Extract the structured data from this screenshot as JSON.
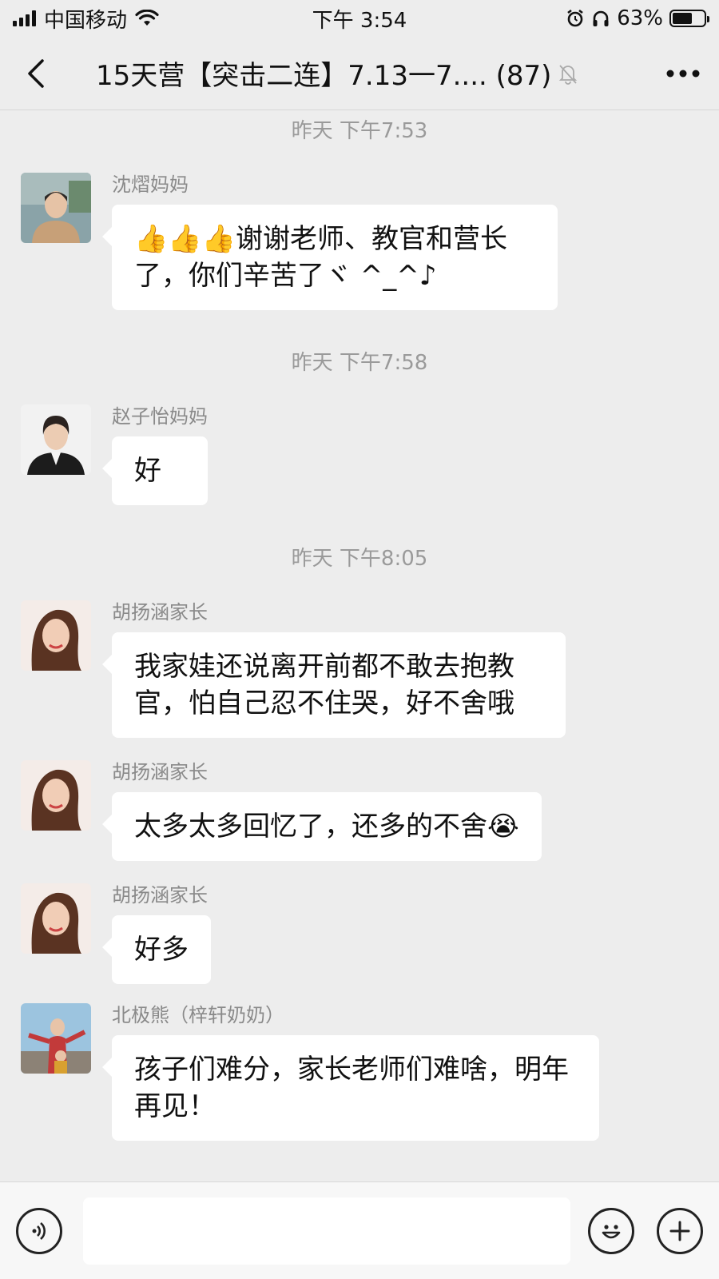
{
  "status_bar": {
    "carrier": "中国移动",
    "time": "下午 3:54",
    "battery": "63%",
    "battery_level": 0.63
  },
  "header": {
    "back_icon": "chevron-left-icon",
    "title": "15天营【突击二连】7.13一7.... (87)",
    "mute_icon": "bell-off-icon",
    "more_icon": "more-horizontal-icon"
  },
  "chat": {
    "timestamps": [
      "昨天 下午7:53",
      "昨天 下午7:58",
      "昨天 下午8:05"
    ],
    "messages": [
      {
        "sender": "沈熠妈妈",
        "text": "👍👍👍谢谢老师、教官和营长了，你们辛苦了ヾ ^_^♪"
      },
      {
        "sender": "赵子怡妈妈",
        "text": "好"
      },
      {
        "sender": "胡扬涵家长",
        "text": "我家娃还说离开前都不敢去抱教官，怕自己忍不住哭，好不舍哦"
      },
      {
        "sender": "胡扬涵家长",
        "text": "太多太多回忆了，还多的不舍😭"
      },
      {
        "sender": "胡扬涵家长",
        "text": "好多"
      },
      {
        "sender": "北极熊（梓轩奶奶）",
        "text": "孩子们难分，家长老师们难啥，明年再见！"
      }
    ]
  },
  "input_bar": {
    "voice_icon": "voice-icon",
    "emoji_icon": "emoji-icon",
    "plus_icon": "plus-icon",
    "placeholder": ""
  }
}
